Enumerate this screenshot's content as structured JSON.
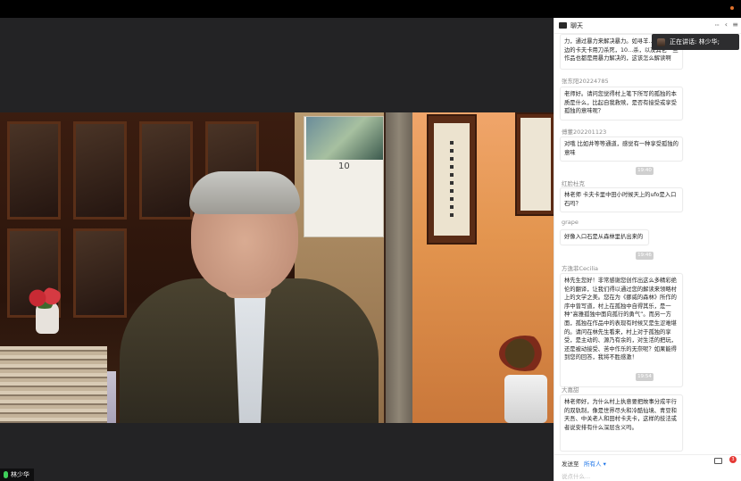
{
  "chat": {
    "title": "聊天",
    "more_label": "···",
    "collapse_label": "‹",
    "menu_label": "≡",
    "messages": [
      {
        "text": "力，通过暴力来解决暴力。如寻羊…作死。海边的卡夫卡用刀杀死，10…杀，以及其它一些作品也都是用暴力解决的，这该怎么解读啊"
      },
      {
        "name": "张东阳20224785",
        "text": "老师好。请问您觉得村上笔下所写的孤独的本质是什么，比起自我救赎，是否有接受或享受孤独的意味呢？"
      },
      {
        "name": "傅董202201123",
        "text": "对哦 比如井等等通道，感觉有一种享受孤独的意味"
      },
      {
        "time": "19:40"
      },
      {
        "name": "红脸杜克",
        "text": "林老师 卡夫卡里中田小时候天上的ufo是入口石吗？"
      },
      {
        "name": "grape",
        "text": "好像入口石是从森林里扒出来的"
      },
      {
        "time": "19:46"
      },
      {
        "name": "方逸菲Cecilia",
        "text": "林先生您好！非常感谢您创作出这么多精彩绝伦的翻译，让我们得以通过您的解读来领略村上的文学之美。您在为《挪威的森林》所作的序中曾写道，村上在孤独中自得其乐，是一种“高雅孤独中面向孤行的勇气”。而另一方面，孤独在作品中的表现有时候又是生涩难堪的。请问在林先生看来，村上对于孤独的享受，是主动的、源乃有余的，对生活的把玩，还是被动接受、苦中作乐的无奈呢？如果能得到您的回答，我将不胜感激！"
      },
      {
        "time": "19:54"
      },
      {
        "name": "大嘉甜",
        "text": "林老师好，为什么村上执意要把故事分成平行的双轨制，像是世界尽头和冷酷仙境、青豆和天吾、中关老人和田村卡夫卡，这样的技法或者说安排有什么深层含义吗。"
      }
    ],
    "send_to_label": "发送至",
    "send_to_value": "所有人 ▾",
    "input_placeholder": "说点什么...",
    "badge_count": "3"
  },
  "speaking": {
    "label": "正在讲话: 林少华;"
  },
  "video": {
    "participant_name": "林少华",
    "calendar_number": "10"
  }
}
